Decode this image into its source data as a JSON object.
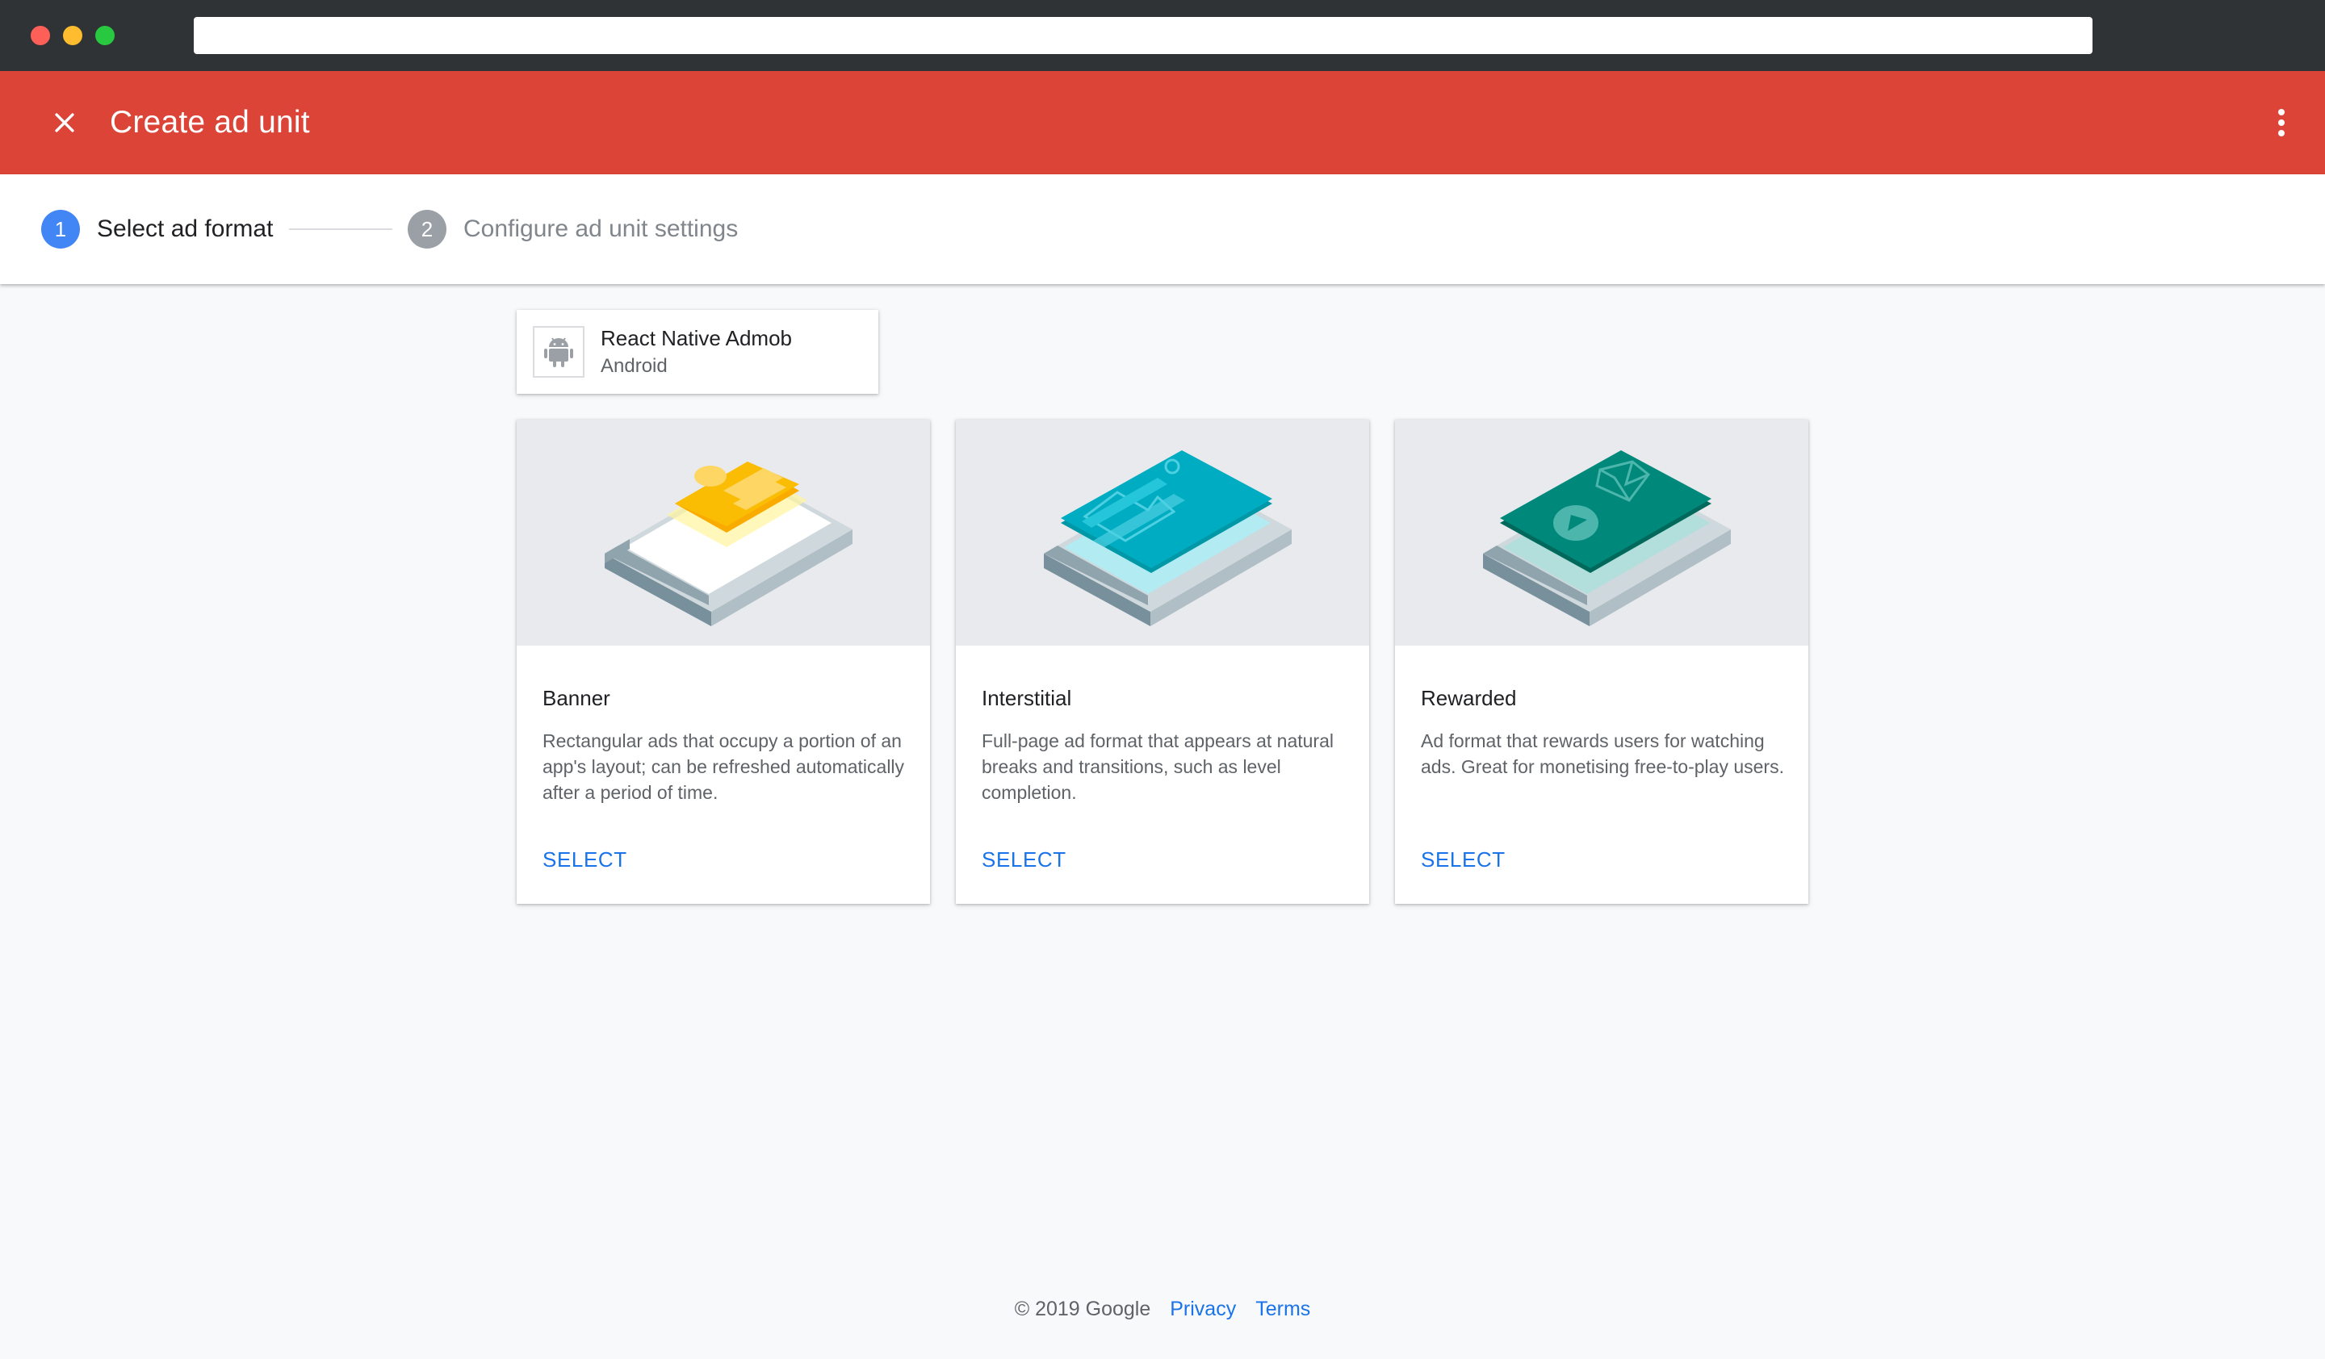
{
  "window": {
    "address_value": ""
  },
  "appbar": {
    "title": "Create ad unit",
    "close_icon": "close-icon",
    "more_icon": "more-vert-icon",
    "background_color": "#db4437"
  },
  "stepper": {
    "steps": [
      {
        "number": "1",
        "label": "Select ad format",
        "active": true
      },
      {
        "number": "2",
        "label": "Configure ad unit settings",
        "active": false
      }
    ],
    "active_color": "#4285f4",
    "inactive_color": "#9aa0a6"
  },
  "app": {
    "name": "React Native Admob",
    "platform": "Android",
    "icon": "android-icon"
  },
  "formats": [
    {
      "title": "Banner",
      "description": "Rectangular ads that occupy a portion of an app's layout; can be refreshed automatically after a period of time.",
      "action": "SELECT",
      "accent_color": "#fbbc04"
    },
    {
      "title": "Interstitial",
      "description": "Full-page ad format that appears at natural breaks and transitions, such as level completion.",
      "action": "SELECT",
      "accent_color": "#00acc1"
    },
    {
      "title": "Rewarded",
      "description": "Ad format that rewards users for watching ads. Great for monetising free-to-play users.",
      "action": "SELECT",
      "accent_color": "#00897b"
    }
  ],
  "footer": {
    "copyright": "© 2019 Google",
    "privacy": "Privacy",
    "terms": "Terms",
    "link_color": "#1a73e8"
  }
}
